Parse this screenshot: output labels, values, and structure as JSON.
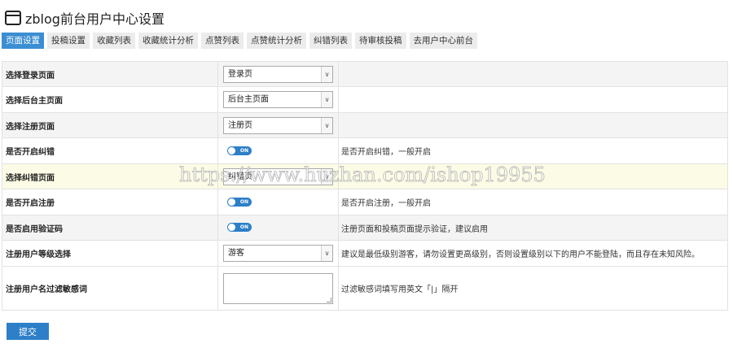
{
  "header": {
    "title": "zblog前台用户中心设置"
  },
  "tabs": [
    {
      "label": "页面设置",
      "active": true
    },
    {
      "label": "投稿设置"
    },
    {
      "label": "收藏列表"
    },
    {
      "label": "收藏统计分析"
    },
    {
      "label": "点赞列表"
    },
    {
      "label": "点赞统计分析"
    },
    {
      "label": "纠错列表"
    },
    {
      "label": "待审核投稿"
    },
    {
      "label": "去用户中心前台"
    }
  ],
  "rows": {
    "login": {
      "label": "选择登录页面",
      "value": "登录页"
    },
    "admin": {
      "label": "选择后台主页面",
      "value": "后台主页面"
    },
    "register": {
      "label": "选择注册页面",
      "value": "注册页"
    },
    "errata_on": {
      "label": "是否开启纠错",
      "toggle": "ON",
      "desc": "是否开启纠错，一般开启"
    },
    "errata": {
      "label": "选择纠错页面",
      "value": "纠错页"
    },
    "reg_on": {
      "label": "是否开启注册",
      "toggle": "ON",
      "desc": "是否开启注册，一般开启"
    },
    "captcha": {
      "label": "是否启用验证码",
      "toggle": "ON",
      "desc": "注册页面和投稿页面提示验证，建议启用"
    },
    "level": {
      "label": "注册用户等级选择",
      "value": "游客",
      "desc": "建议是最低级别游客，请勿设置更高级别，否则设置级别以下的用户不能登陆，而且存在未知风险。"
    },
    "filter": {
      "label": "注册用户名过滤敏感词",
      "value": "",
      "desc": "过滤敏感词填写用英文「|」隔开"
    }
  },
  "watermark": "https://www.huzhan.com/ishop19955",
  "submit_label": "提交",
  "colors": {
    "accent": "#2d7fc8",
    "tab_active": "#3b8ed3"
  }
}
